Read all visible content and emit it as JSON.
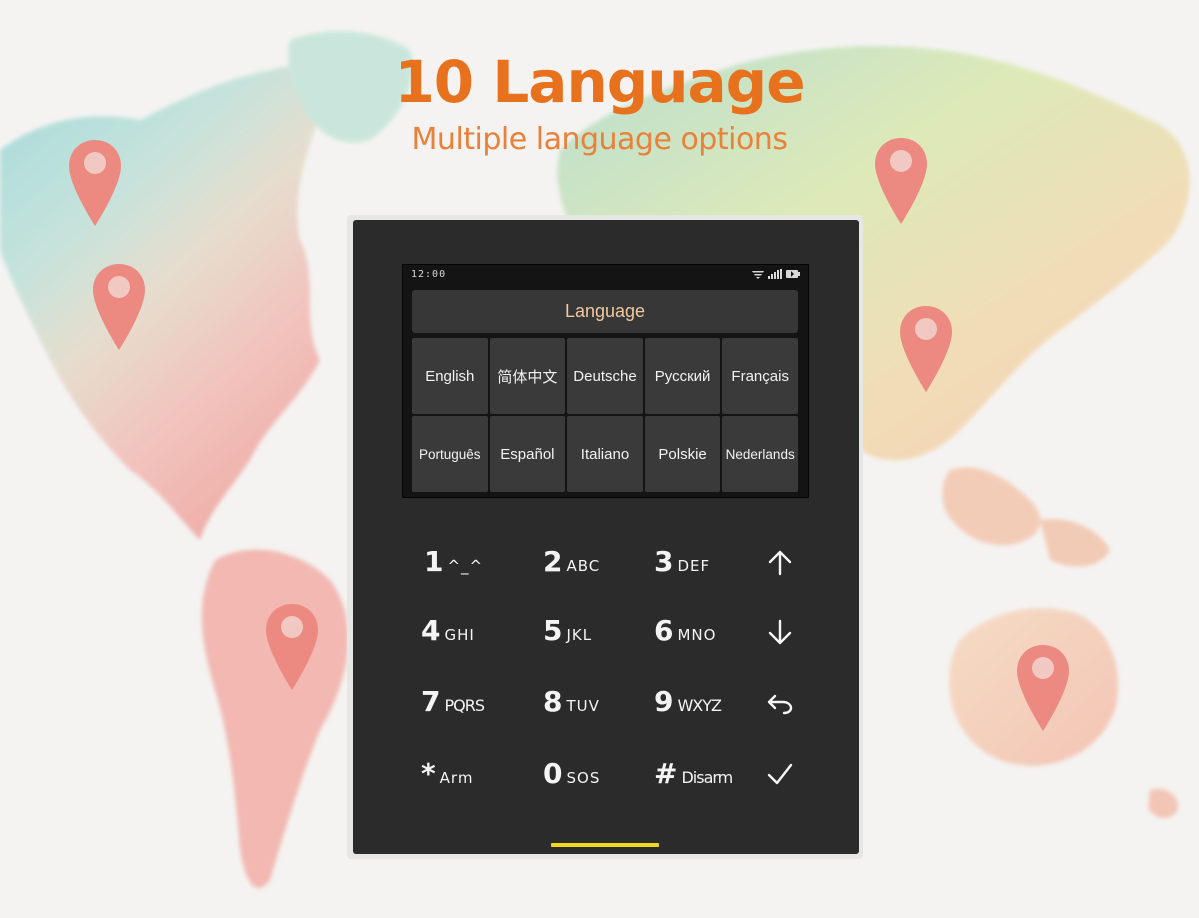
{
  "heading": {
    "title": "10 Language",
    "subtitle": "Multiple language options"
  },
  "screen": {
    "status_time": "12:00",
    "status_icons": [
      "wifi-icon",
      "signal-icon",
      "battery-icon"
    ],
    "title": "Language",
    "languages": [
      "English",
      "简体中文",
      "Deutsche",
      "Русский",
      "Français",
      "Português",
      "Español",
      "Italiano",
      "Polskie",
      "Nederlands"
    ]
  },
  "keypad": {
    "keys": [
      {
        "num": "1",
        "letters": "^_^"
      },
      {
        "num": "2",
        "letters": "ABC"
      },
      {
        "num": "3",
        "letters": "DEF"
      },
      {
        "num": "4",
        "letters": "GHI"
      },
      {
        "num": "5",
        "letters": "JKL"
      },
      {
        "num": "6",
        "letters": "MNO"
      },
      {
        "num": "7",
        "letters": "PQRS"
      },
      {
        "num": "8",
        "letters": "TUV"
      },
      {
        "num": "9",
        "letters": "WXYZ"
      },
      {
        "num": "*",
        "letters": "Arm"
      },
      {
        "num": "0",
        "letters": "SOS"
      },
      {
        "num": "#",
        "letters": "Disarm"
      }
    ],
    "nav_icons": [
      "arrow-up-icon",
      "arrow-down-icon",
      "back-icon",
      "checkmark-icon"
    ]
  },
  "colors": {
    "accent": "#e8711e",
    "device_body": "#2b2b2b",
    "screen_button": "#3a3a3a",
    "indicator": "#f2d71c",
    "pin": "#ec8a82"
  }
}
